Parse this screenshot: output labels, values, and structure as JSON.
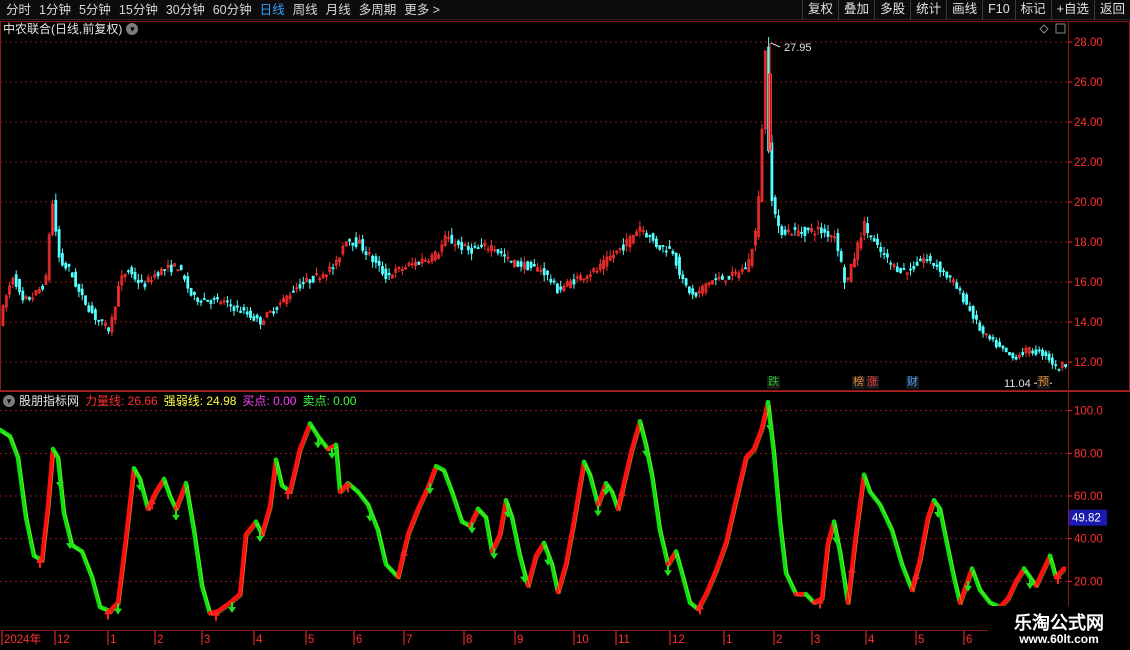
{
  "toolbar": {
    "periods": [
      "分时",
      "1分钟",
      "5分钟",
      "15分钟",
      "30分钟",
      "60分钟",
      "日线",
      "周线",
      "月线",
      "多周期",
      "更多 >"
    ],
    "active_period": "日线",
    "right_buttons": [
      "复权",
      "叠加",
      "多股",
      "统计",
      "画线",
      "F10",
      "标记",
      "+自选",
      "返回"
    ]
  },
  "price_chart": {
    "title": "中农联合(日线,前复权)",
    "y_ticks": [
      "28.00",
      "26.00",
      "24.00",
      "22.00",
      "20.00",
      "18.00",
      "16.00",
      "14.00",
      "12.00"
    ],
    "ylim": [
      11,
      28
    ],
    "high_label": "27.95",
    "low_label": "11.04",
    "badges": [
      {
        "text": "跌",
        "color": "#22c022"
      },
      {
        "text": "榜",
        "color": "#e08830"
      },
      {
        "text": "涨",
        "color": "#ff4040"
      },
      {
        "text": "财",
        "color": "#4aa0ff"
      },
      {
        "text": "预",
        "color": "#e08830"
      }
    ]
  },
  "indicator": {
    "name": "股朋指标网",
    "legend": [
      {
        "label": "力量线: 26.66",
        "color": "#ff3030"
      },
      {
        "label": "强弱线: 24.98",
        "color": "#ffff40"
      },
      {
        "label": "买点: 0.00",
        "color": "#ff40ff"
      },
      {
        "label": "卖点: 0.00",
        "color": "#40ff40"
      }
    ],
    "y_ticks": [
      "100.0",
      "80.00",
      "60.00",
      "40.00",
      "20.00"
    ],
    "ylim": [
      0,
      105
    ],
    "current_value": "49.82"
  },
  "x_axis": {
    "labels": [
      "2024年",
      "12",
      "1",
      "2",
      "3",
      "4",
      "5",
      "6",
      "7",
      "8",
      "9",
      "10",
      "11",
      "12",
      "1",
      "2",
      "3",
      "4",
      "5",
      "6"
    ]
  },
  "watermark": {
    "title": "乐淘公式网",
    "url": "www.60lt.com"
  },
  "colors": {
    "up": "#ff3030",
    "down": "#54ffff",
    "grid": "#8b1a1a",
    "axis_text": "#ff3030",
    "power_up": "#ff1010",
    "power_down": "#10e010"
  }
}
